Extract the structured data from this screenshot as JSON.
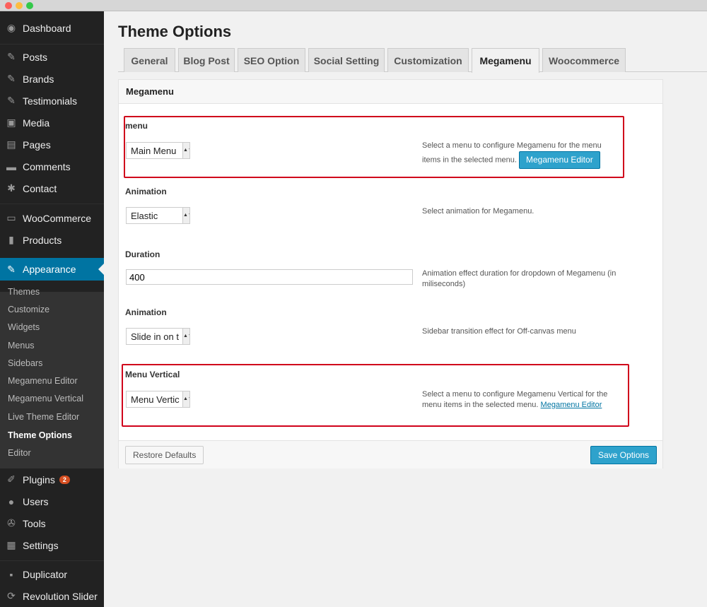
{
  "sidebar": {
    "items": [
      {
        "label": "Dashboard",
        "icon": "dashboard-icon",
        "glyph": "◉"
      },
      {
        "label": "Posts",
        "icon": "pin-icon",
        "glyph": "✎"
      },
      {
        "label": "Brands",
        "icon": "pin-icon",
        "glyph": "✎"
      },
      {
        "label": "Testimonials",
        "icon": "pin-icon",
        "glyph": "✎"
      },
      {
        "label": "Media",
        "icon": "media-icon",
        "glyph": "▣"
      },
      {
        "label": "Pages",
        "icon": "pages-icon",
        "glyph": "▤"
      },
      {
        "label": "Comments",
        "icon": "comments-icon",
        "glyph": "▬"
      },
      {
        "label": "Contact",
        "icon": "gear-icon",
        "glyph": "✱"
      },
      {
        "label": "WooCommerce",
        "icon": "woocommerce-icon",
        "glyph": "▭"
      },
      {
        "label": "Products",
        "icon": "products-icon",
        "glyph": "▮"
      },
      {
        "label": "Appearance",
        "icon": "brush-icon",
        "glyph": "✎"
      },
      {
        "label": "Plugins",
        "icon": "plugin-icon",
        "glyph": "✐",
        "badge": "2"
      },
      {
        "label": "Users",
        "icon": "user-icon",
        "glyph": "●"
      },
      {
        "label": "Tools",
        "icon": "wrench-icon",
        "glyph": "✇"
      },
      {
        "label": "Settings",
        "icon": "settings-icon",
        "glyph": "▦"
      },
      {
        "label": "Duplicator",
        "icon": "duplicator-icon",
        "glyph": "▪"
      },
      {
        "label": "Revolution Slider",
        "icon": "slider-icon",
        "glyph": "⟳"
      }
    ],
    "submenu": [
      "Themes",
      "Customize",
      "Widgets",
      "Menus",
      "Sidebars",
      "Megamenu Editor",
      "Megamenu Vertical",
      "Live Theme Editor",
      "Theme Options",
      "Editor"
    ]
  },
  "page": {
    "title": "Theme Options",
    "tabs": [
      "General",
      "Blog Post",
      "SEO Option",
      "Social Setting",
      "Customization",
      "Megamenu",
      "Woocommerce"
    ],
    "active_tab": "Megamenu"
  },
  "panel": {
    "heading": "Megamenu",
    "menu": {
      "label": "menu",
      "value": "Main Menu",
      "desc": "Select a menu to configure Megamenu for the menu items in the selected menu.",
      "button": "Megamenu Editor"
    },
    "animation1": {
      "label": "Animation",
      "value": "Elastic",
      "desc": "Select animation for Megamenu."
    },
    "duration": {
      "label": "Duration",
      "value": "400",
      "desc": "Animation effect duration for dropdown of Megamenu (in miliseconds)"
    },
    "animation2": {
      "label": "Animation",
      "value": "Slide in on t",
      "desc": "Sidebar transition effect for Off-canvas menu"
    },
    "vertical": {
      "label": "Menu Vertical",
      "value": "Menu Vertic",
      "desc": "Select a menu to configure Megamenu Vertical for the menu items in the selected menu.",
      "link": "Megamenu Editor"
    },
    "restore_button": "Restore Defaults",
    "save_button": "Save Options"
  },
  "colors": {
    "sidebar_bg": "#222222",
    "active_bg": "#0074a2",
    "primary_button": "#2ea2cc",
    "highlight_border": "#d0021b"
  }
}
